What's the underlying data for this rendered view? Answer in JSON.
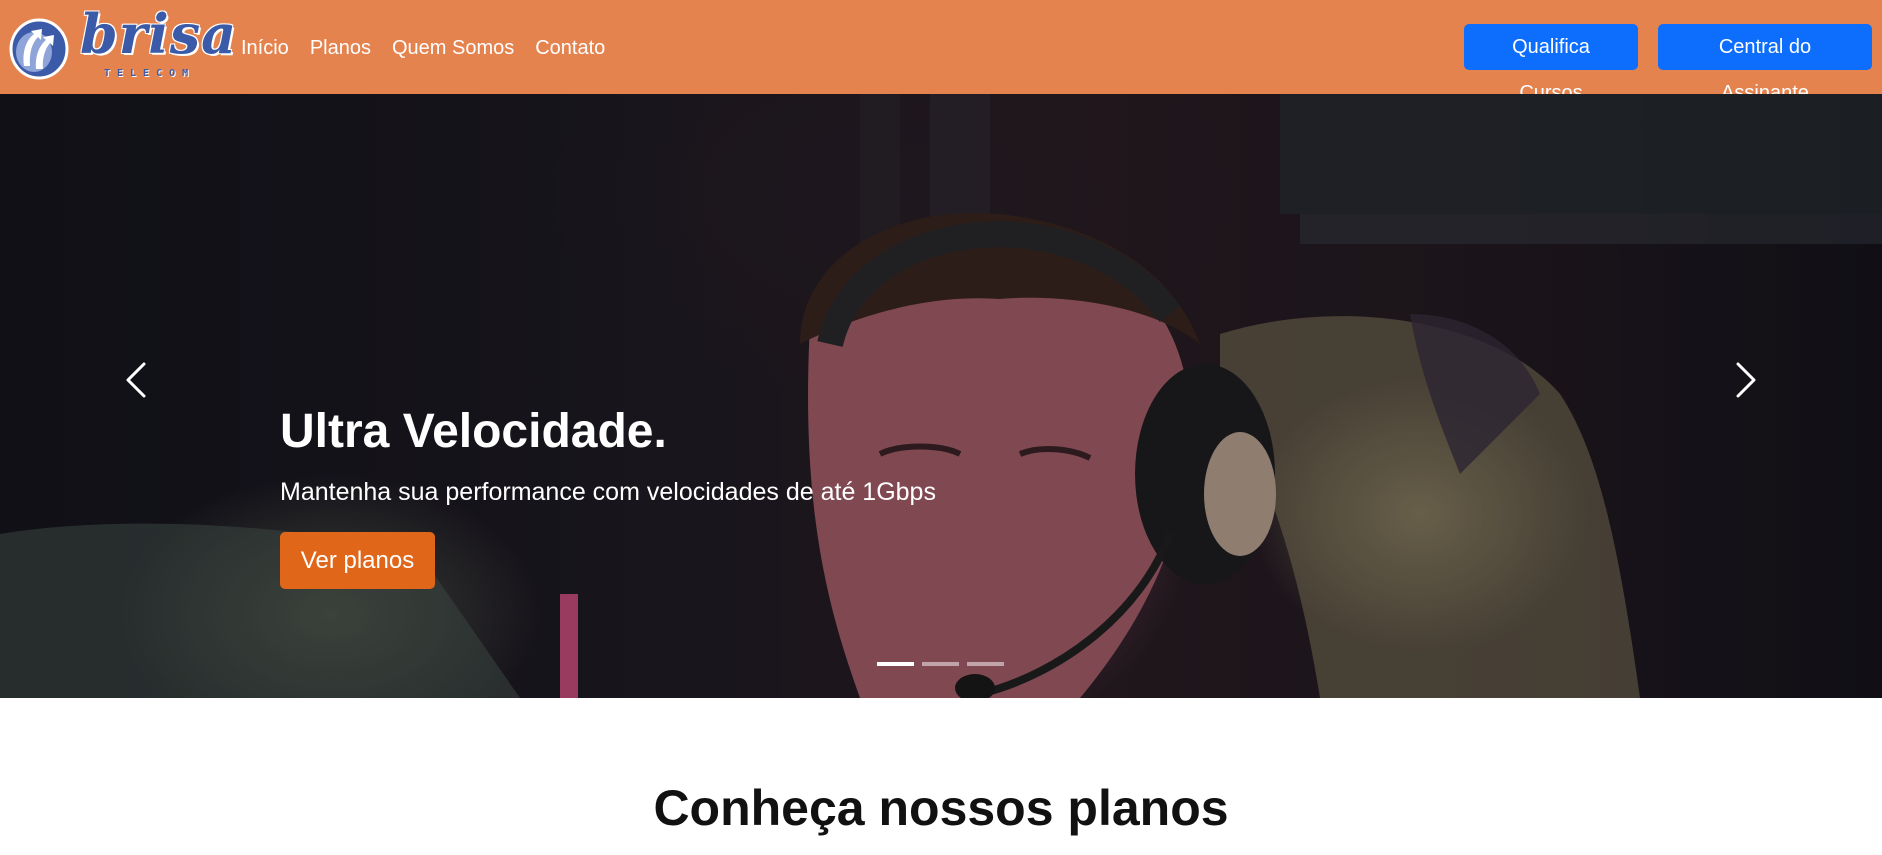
{
  "brand": {
    "name": "brisa",
    "subtitle": "TELECOM",
    "colors": {
      "navbar": "#e5834f",
      "logo": "#3b5aa8",
      "primary_button": "#0d6efd",
      "cta_button": "#e06619"
    }
  },
  "nav": {
    "links": [
      "Início",
      "Planos",
      "Quem Somos",
      "Contato"
    ],
    "buttons": {
      "qualifica": "Qualifica Cursos",
      "central": "Central do Assinante"
    }
  },
  "hero": {
    "title": "Ultra Velocidade.",
    "subtitle": "Mantenha sua performance com velocidades de até 1Gbps",
    "cta": "Ver planos",
    "slides_count": 3,
    "active_slide": 1,
    "prev_icon": "chevron-left-icon",
    "next_icon": "chevron-right-icon"
  },
  "plans": {
    "heading": "Conheça nossos planos"
  }
}
